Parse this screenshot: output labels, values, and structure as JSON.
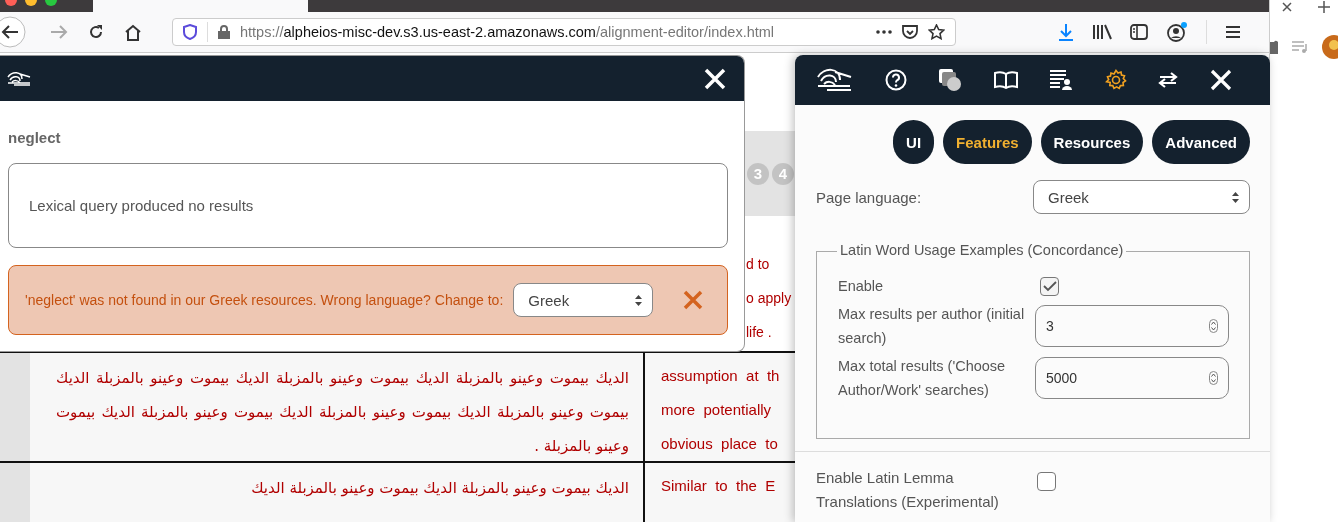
{
  "browser": {
    "url_scheme": "https://",
    "url_host": "alpheios-misc-dev.s3.us-east-2.amazonaws.com",
    "url_path": "/alignment-editor/index.html"
  },
  "page": {
    "step_badges": [
      "3",
      "4"
    ],
    "rows": [
      {
        "english": [
          "d to",
          "o apply",
          "life ."
        ]
      },
      {
        "arabic": "الديك بيموت وعينو بالمزبلة الديك بيموت وعينو بالمزبلة الديك بيموت وعينو بالمزبلة الديك بيموت وعينو بالمزبلة الديك بيموت وعينو بالمزبلة الديك بيموت وعينو بالمزبلة الديك بيموت وعينو بالمزبلة .",
        "english": [
          "assumption  at  th",
          "more  potentially",
          "obvious  place  to"
        ]
      },
      {
        "arabic": "الديك بيموت وعينو بالمزبلة الديك بيموت وعينو بالمزبلة الديك",
        "english": [
          "Similar  to  the  E"
        ]
      }
    ]
  },
  "lookup_popup": {
    "word": "neglect",
    "message": "Lexical query produced no results",
    "alert": {
      "text": "'neglect' was not found in our Greek resources. Wrong language? Change to:",
      "language": "Greek"
    }
  },
  "settings_panel": {
    "toolbar": [
      {
        "kind": "logo",
        "selected": false
      },
      {
        "kind": "help",
        "selected": false
      },
      {
        "kind": "resources",
        "selected": false
      },
      {
        "kind": "book",
        "selected": false
      },
      {
        "kind": "list",
        "selected": false
      },
      {
        "kind": "settings",
        "selected": true
      },
      {
        "kind": "swap",
        "selected": false
      },
      {
        "kind": "close",
        "selected": false
      }
    ],
    "tabs": [
      {
        "label": "UI",
        "selected": false
      },
      {
        "label": "Features",
        "selected": true
      },
      {
        "label": "Resources",
        "selected": false
      },
      {
        "label": "Advanced",
        "selected": false
      }
    ],
    "page_language": {
      "label": "Page language:",
      "value": "Greek"
    },
    "concordance": {
      "legend": "Latin Word Usage Examples (Concordance)",
      "enable": {
        "label": "Enable",
        "checked": true
      },
      "max_per_author": {
        "label": "Max results per author (initial search)",
        "value": "3"
      },
      "max_total": {
        "label": "Max total results ('Choose Author/Work' searches)",
        "value": "5000"
      }
    },
    "lemma_translations": {
      "label": "Enable Latin Lemma Translations (Experimental)",
      "checked": false
    }
  }
}
